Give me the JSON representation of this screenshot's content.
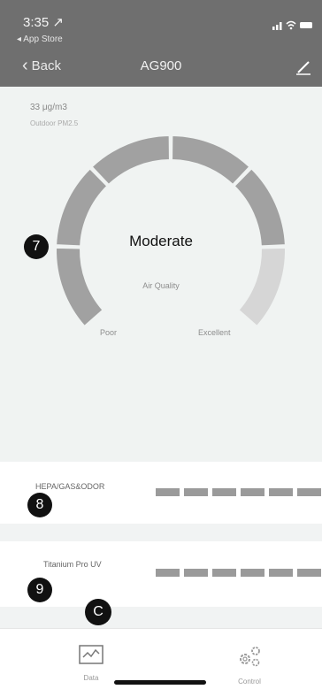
{
  "status_bar": {
    "time": "3:35 ↗",
    "back_app": "◂ App Store",
    "icons": "📶"
  },
  "nav": {
    "back_label": "Back",
    "title": "AG900"
  },
  "outdoor": {
    "value": "33 μg/m3",
    "label": "Outdoor PM2.5"
  },
  "gauge": {
    "quality": "Moderate",
    "sub_label": "Air Quality",
    "poor_label": "Poor",
    "excellent_label": "Excellent",
    "colors": {
      "active": "#a1a1a1",
      "inactive": "#d6d6d6"
    },
    "level_segments_active": 5,
    "segments_total": 6
  },
  "badges": {
    "seven": "7",
    "eight": "8",
    "nine": "9",
    "c": "C"
  },
  "filters": [
    {
      "name": "HEPA/GAS&ODOR",
      "bars_total": 6,
      "bars_filled": 6
    },
    {
      "name": "Titanium Pro UV",
      "bars_total": 6,
      "bars_filled": 6
    }
  ],
  "tabs": {
    "data": {
      "label": "Data",
      "icon": "chart-icon"
    },
    "control": {
      "label": "Control",
      "icon": "gears-icon"
    }
  }
}
